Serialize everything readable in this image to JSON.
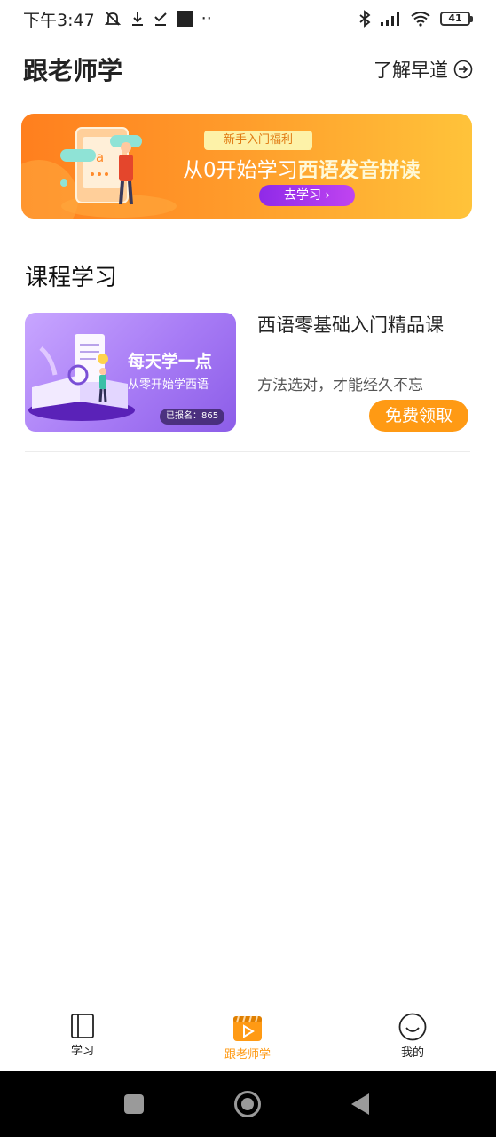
{
  "status_bar": {
    "time": "下午3:47",
    "dots": "··",
    "battery": "41"
  },
  "header": {
    "title": "跟老师学",
    "learn_link": "了解早道"
  },
  "banner": {
    "badge": "新手入门福利",
    "headline_prefix": "从0开始学习",
    "headline_emphasis": "西语发音拼读",
    "cta": "去学习 ›",
    "art_letter": "a"
  },
  "courses_section": {
    "title": "课程学习"
  },
  "course": {
    "thumb_title": "每天学一点",
    "thumb_subtitle": "从零开始学西语",
    "enrolled": "已报名：865",
    "title": "西语零基础入门精品课",
    "description": "方法选对，才能经久不忘",
    "action": "免费领取"
  },
  "tabs": [
    {
      "label": "学习",
      "icon": "notebook-icon",
      "active": false
    },
    {
      "label": "跟老师学",
      "icon": "video-clapper-icon",
      "active": true
    },
    {
      "label": "我的",
      "icon": "smiley-face-icon",
      "active": false
    }
  ],
  "colors": {
    "accent": "#ff9a14",
    "banner_start": "#ff7f1e",
    "banner_end": "#ffc33a",
    "cta_purple": "#8f2ae8",
    "thumb_purple": "#a77bf5"
  }
}
